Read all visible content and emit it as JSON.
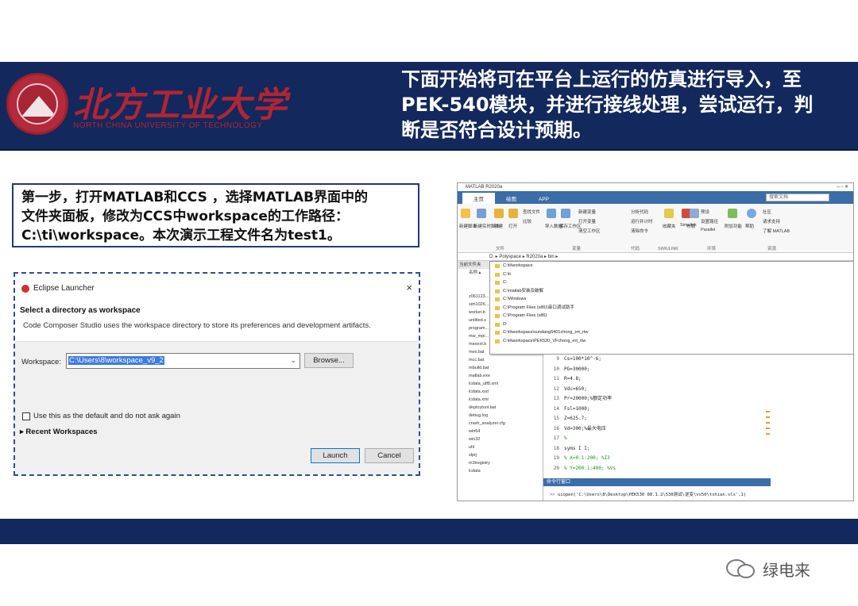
{
  "header": {
    "logo_name": "北方工业大学",
    "logo_en": "NORTH CHINA UNIVERSITY OF TECHNOLOGY",
    "banner_lines": [
      "下面开始将可在平台上运行的仿真进行导入，至",
      "PEK-540模块，并进行接线处理，尝试运行，判",
      "断是否符合设计预期。"
    ]
  },
  "step": {
    "lines": [
      "第一步，打开MATLAB和CCS ，选择MATLAB界面中的",
      "文件夹面板，修改为CCS中workspace的工作路径：",
      "C:\\ti\\workspace。本次演示工程文件名为test1。"
    ]
  },
  "eclipse": {
    "title": "Eclipse Launcher",
    "close": "×",
    "heading": "Select a directory as workspace",
    "description": "Code Composer Studio uses the workspace directory to store its preferences and development artifacts.",
    "workspace_label": "Workspace:",
    "workspace_value": "C:\\Users\\8\\workspace_v9_2",
    "browse": "Browse...",
    "checkbox_label": "Use this as the default and do not ask again",
    "recent": "Recent Workspaces",
    "launch": "Launch",
    "cancel": "Cancel"
  },
  "matlab": {
    "title": "MATLAB R2020a",
    "tabs": [
      "主页",
      "绘图",
      "APP"
    ],
    "search": "搜索文档",
    "ribbon": {
      "items": [
        "新建脚本",
        "新建实时脚本",
        "新建",
        "打开",
        "查找文件",
        "比较",
        "导入数据",
        "保存工作区",
        "新建变量",
        "打开变量",
        "清空工作区",
        "分析代码",
        "运行并计时",
        "清除命令",
        "收藏夹",
        "Simulink",
        "布局",
        "预设",
        "设置路径",
        "Parallel",
        "附加功能",
        "帮助",
        "社区",
        "请求支持",
        "了解 MATLAB"
      ],
      "groups": [
        "文件",
        "变量",
        "代码",
        "SIMULINK",
        "环境",
        "资源"
      ]
    },
    "path": "D: ▸ Polyspace ▸ R2020a ▸ bin ▸",
    "left_header": "当前文件夹",
    "left_files": [
      "名称 ▴",
      "m3iregistry",
      "registry",
      "util",
      "win32",
      "win64",
      "mex.bat",
      "mcc.bat",
      "mbuild.bat",
      "matlab.exe",
      "lcdata_utf8.xml",
      "lcdata.xsd",
      "lcdata.xml",
      "deploytool.bat",
      "debug.log",
      "crash_analyzer.cfg",
      "win64",
      "win32",
      "util",
      "slprj",
      "m3iregistry",
      "lcdata"
    ],
    "left_files_top": [
      "z061123...",
      "sim1026...",
      "worker.b",
      "untitled.s",
      "program...",
      "mw_mpi...",
      "mexext.b"
    ],
    "dropdown": [
      "C:\\ti\\workspace",
      "C:\\ti",
      "C:",
      "C:\\matlab安装及破解",
      "C:\\Windows",
      "C:\\Program Files (x86)\\串口调试助手",
      "C:\\Program Files (x86)",
      "D:",
      "C:\\ti\\workspace\\sundang5401chong_ert_rtw",
      "C:\\ti\\workspace\\PEK530_VFchong_ert_rtw"
    ],
    "code": [
      {
        "n": "9",
        "t": "Cs=100*10^-6;"
      },
      {
        "n": "10",
        "t": "PG=30000;"
      },
      {
        "n": "11",
        "t": "R=4.8;"
      },
      {
        "n": "12",
        "t": "Vdc=650;"
      },
      {
        "n": "13",
        "t": "Pr=20000;%额定功率"
      },
      {
        "n": "14",
        "t": "Fsl=1000;"
      },
      {
        "n": "15",
        "t": "Z=625.7;"
      },
      {
        "n": "16",
        "t": "Vd=300;%最大电压"
      },
      {
        "n": "17",
        "t": "%"
      },
      {
        "n": "18",
        "t": "syms I I;"
      },
      {
        "n": "19",
        "t": "% X=0:1:200;   %I3"
      },
      {
        "n": "20",
        "t": "% Y=200:1:400;   %Vs"
      }
    ],
    "cmd_header": "命令行窗口",
    "cmd_prompt": ">> ",
    "cmd_text": "uiopen('C:\\Users\\8\\Desktop\\PEK530 08.1.2\\530测试\\逆变\\vs50\\tshian.slx',1)"
  },
  "watermark": "绿电来",
  "colors": {
    "banner": "#13285c",
    "logo_red": "#b02534",
    "dialog_border": "#2c4f93",
    "matlab_blue": "#3b6ea8"
  }
}
